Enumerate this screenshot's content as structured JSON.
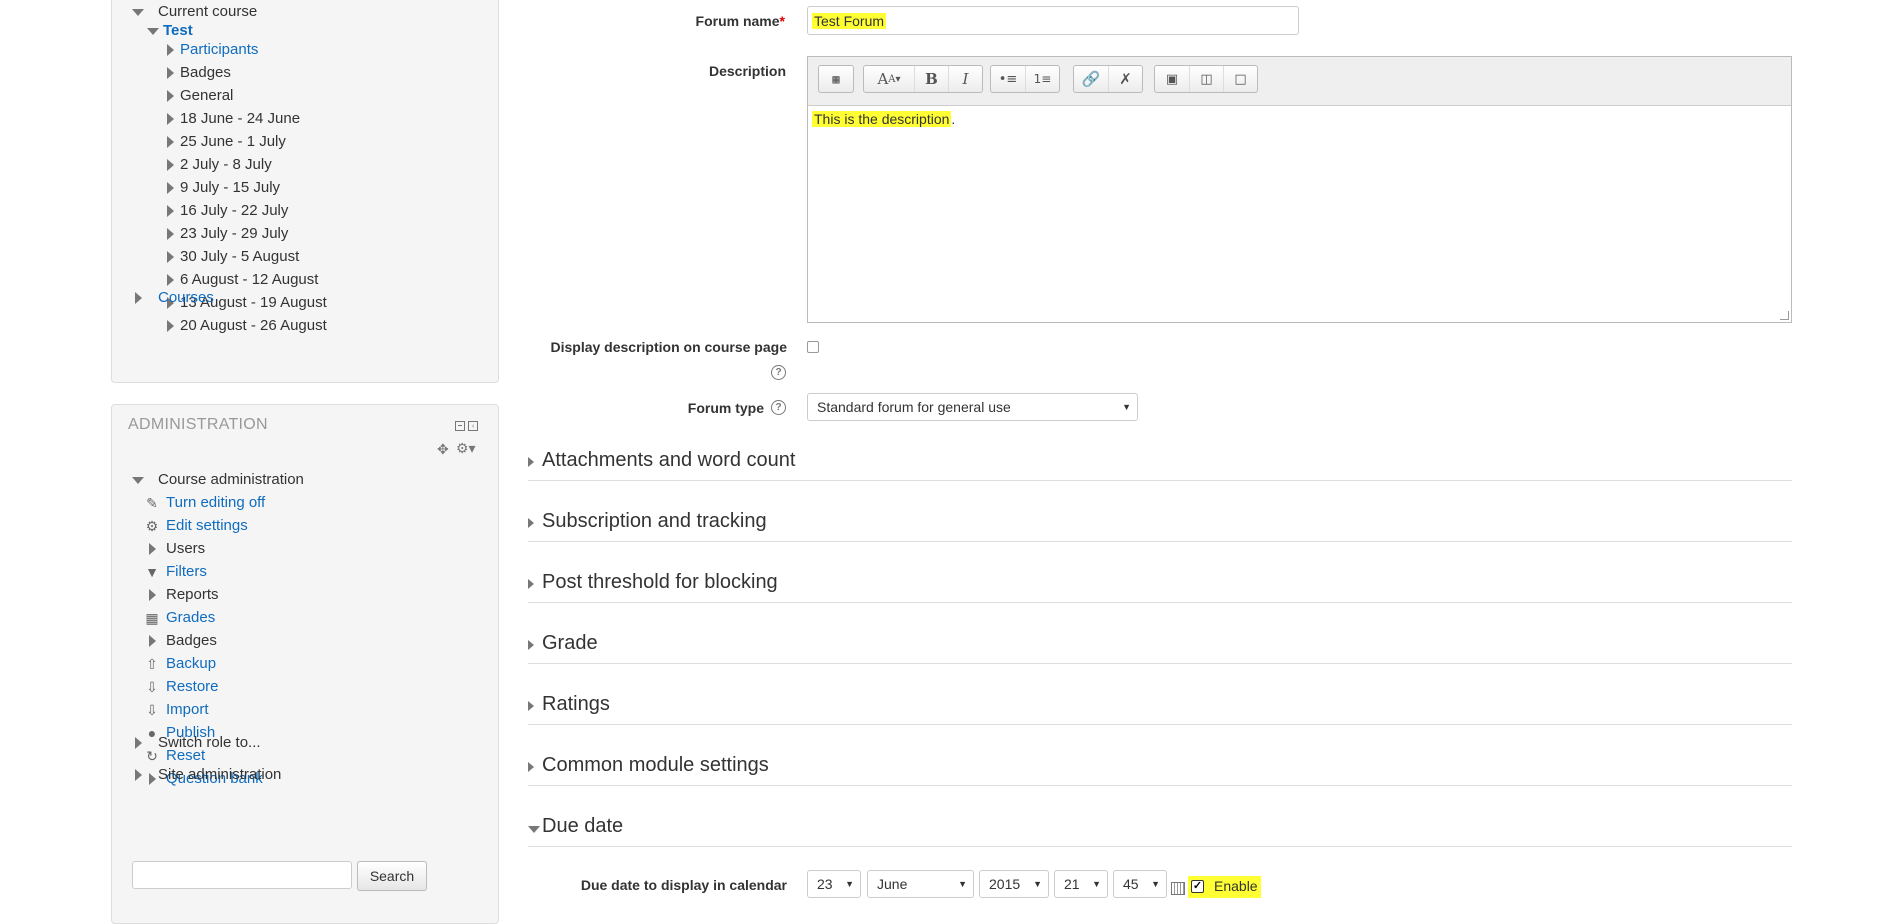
{
  "navigation": {
    "current_course": "Current course",
    "course_name": "Test",
    "course_children": [
      {
        "label": "Participants",
        "link": true
      },
      {
        "label": "Badges",
        "link": false
      },
      {
        "label": "General",
        "link": false
      },
      {
        "label": "18 June - 24 June",
        "link": false
      },
      {
        "label": "25 June - 1 July",
        "link": false
      },
      {
        "label": "2 July - 8 July",
        "link": false
      },
      {
        "label": "9 July - 15 July",
        "link": false
      },
      {
        "label": "16 July - 22 July",
        "link": false
      },
      {
        "label": "23 July - 29 July",
        "link": false
      },
      {
        "label": "30 July - 5 August",
        "link": false
      },
      {
        "label": "6 August - 12 August",
        "link": false
      },
      {
        "label": "13 August - 19 August",
        "link": false
      },
      {
        "label": "20 August - 26 August",
        "link": false
      }
    ],
    "courses": "Courses"
  },
  "administration": {
    "title": "ADMINISTRATION",
    "course_admin": "Course administration",
    "items": [
      {
        "label": "Turn editing off",
        "icon": "pencil-icon",
        "link": true
      },
      {
        "label": "Edit settings",
        "icon": "gear-icon",
        "link": true
      },
      {
        "label": "Users",
        "icon": "expand-arrow",
        "link": false
      },
      {
        "label": "Filters",
        "icon": "filter-icon",
        "link": true
      },
      {
        "label": "Reports",
        "icon": "expand-arrow",
        "link": false
      },
      {
        "label": "Grades",
        "icon": "grades-icon",
        "link": true
      },
      {
        "label": "Badges",
        "icon": "expand-arrow",
        "link": false
      },
      {
        "label": "Backup",
        "icon": "backup-icon",
        "link": true
      },
      {
        "label": "Restore",
        "icon": "restore-icon",
        "link": true
      },
      {
        "label": "Import",
        "icon": "import-icon",
        "link": true
      },
      {
        "label": "Publish",
        "icon": "publish-icon",
        "link": true
      },
      {
        "label": "Reset",
        "icon": "reset-icon",
        "link": true
      },
      {
        "label": "Question bank",
        "icon": "expand-arrow",
        "link": true
      }
    ],
    "switch_role": "Switch role to...",
    "site_admin": "Site administration",
    "search_button": "Search"
  },
  "form": {
    "forum_name_label": "Forum name",
    "forum_name_required": "*",
    "forum_name_value": "Test Forum",
    "description_label": "Description",
    "description_text": "This is the description",
    "description_period": ".",
    "display_description_label": "Display description on course page",
    "display_description_checked": false,
    "forum_type_label": "Forum type",
    "forum_type_value": "Standard forum for general use",
    "help_glyph": "?",
    "sections": [
      {
        "title": "Attachments and word count",
        "expanded": false
      },
      {
        "title": "Subscription and tracking",
        "expanded": false
      },
      {
        "title": "Post threshold for blocking",
        "expanded": false
      },
      {
        "title": "Grade",
        "expanded": false
      },
      {
        "title": "Ratings",
        "expanded": false
      },
      {
        "title": "Common module settings",
        "expanded": false
      },
      {
        "title": "Due date",
        "expanded": true
      }
    ],
    "due_date_label": "Due date to display in calendar",
    "due_day": "23",
    "due_month": "June",
    "due_year": "2015",
    "due_hour": "21",
    "due_minute": "45",
    "enable_label": "Enable",
    "enable_checked": true
  },
  "colors": {
    "highlight": "#ffff33",
    "link": "#0f6cbf"
  }
}
